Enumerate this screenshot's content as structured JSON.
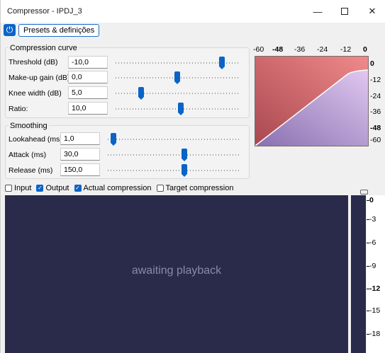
{
  "window": {
    "title": "Compressor - IPDJ_3",
    "min_icon": "minimize-icon",
    "max_icon": "maximize-icon",
    "close_icon": "close-icon"
  },
  "toolbar": {
    "power_icon": "power-icon",
    "presets_label": "Presets & definições"
  },
  "compression": {
    "title": "Compression curve",
    "threshold": {
      "label": "Threshold (dB)",
      "value": "-10,0",
      "level": 0.88
    },
    "makeup": {
      "label": "Make-up gain (dB)",
      "value": "0,0",
      "level": 0.5
    },
    "knee": {
      "label": "Knee width (dB)",
      "value": "5,0",
      "level": 0.19
    },
    "ratio": {
      "label": "Ratio:",
      "value": "10,0",
      "level": 0.53
    }
  },
  "smoothing": {
    "title": "Smoothing",
    "lookahead": {
      "label": "Lookahead (ms)",
      "value": "1,0",
      "level": 0.02
    },
    "attack": {
      "label": "Attack (ms)",
      "value": "30,0",
      "level": 0.59
    },
    "release": {
      "label": "Release (ms)",
      "value": "150,0",
      "level": 0.59
    }
  },
  "graph": {
    "x_ticks": [
      "-60",
      "-48",
      "-36",
      "-24",
      "-12",
      "0"
    ],
    "y_ticks": [
      "0",
      "-12",
      "-24",
      "-36",
      "-48",
      "-60"
    ]
  },
  "checkboxes": [
    {
      "label": "Input",
      "checked": false
    },
    {
      "label": "Output",
      "checked": true
    },
    {
      "label": "Actual compression",
      "checked": true
    },
    {
      "label": "Target compression",
      "checked": false
    }
  ],
  "scope": {
    "message": "awaiting playback",
    "background": "#2a2a4a"
  },
  "meter_scale": [
    "0",
    "-3",
    "-6",
    "-9",
    "-12",
    "-15",
    "-18"
  ]
}
